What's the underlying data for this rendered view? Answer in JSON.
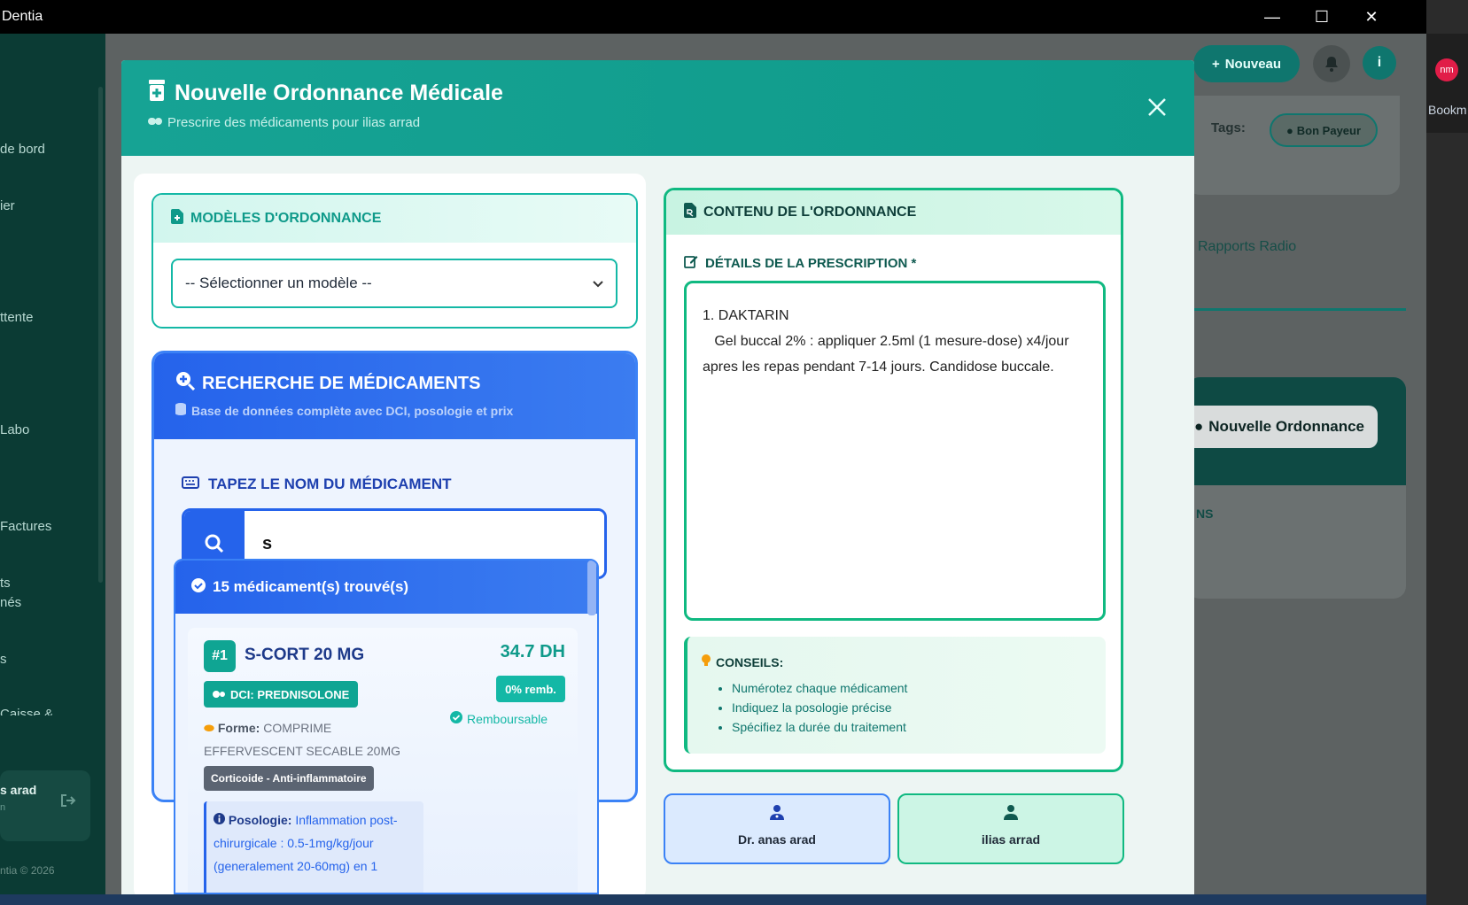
{
  "window": {
    "title": "Dentia",
    "minimize": "—",
    "maximize": "☐",
    "close": "✕"
  },
  "browser": {
    "profile_initials": "nm",
    "bookmarks_label": "Bookm"
  },
  "sidebar": {
    "items": [
      {
        "label": "de bord"
      },
      {
        "label": "ier"
      },
      {
        "label": "ttente"
      },
      {
        "label": "Labo"
      },
      {
        "label": "Factures"
      },
      {
        "label": "ts"
      },
      {
        "label": "nés"
      },
      {
        "label": "s"
      },
      {
        "label": "Caisse &"
      }
    ],
    "user_name": "s arad",
    "user_sub": "n",
    "footer": "ntia © 2026"
  },
  "topbar": {
    "nouveau_label": "Nouveau",
    "avatar_initial": "i"
  },
  "background": {
    "tags_label": "Tags:",
    "tag_bon_payeur": "Bon Payeur",
    "rapports_radio": "Rapports Radio",
    "nouvelle_ordonnance_btn": "Nouvelle Ordonnance",
    "section_ns": "NS"
  },
  "modal": {
    "title": "Nouvelle Ordonnance Médicale",
    "subtitle": "Prescrire des médicaments pour ilias arrad",
    "close": "✕",
    "models": {
      "heading": "MODÈLES D'ORDONNANCE",
      "select_value": "-- Sélectionner un modèle --"
    },
    "search": {
      "heading": "RECHERCHE DE MÉDICAMENTS",
      "subheading": "Base de données complète avec DCI, posologie et prix",
      "input_label": "TAPEZ LE NOM DU MÉDICAMENT",
      "input_value": "s"
    },
    "results": {
      "count_label": "15 médicament(s) trouvé(s)",
      "items": [
        {
          "rank": "#1",
          "name": "S-CORT 20 MG",
          "price": "34.7 DH",
          "remb_rate": "0% remb.",
          "remb_status": "Remboursable",
          "dci": "DCI: PREDNISOLONE",
          "forme_label": "Forme:",
          "forme_value": "COMPRIME EFFERVESCENT SECABLE 20MG",
          "classe": "Corticoide - Anti-inflammatoire",
          "posologie_label": "Posologie:",
          "posologie_value": "Inflammation post-chirurgicale : 0.5-1mg/kg/jour (generalement 20-60mg) en 1"
        }
      ]
    },
    "content": {
      "heading": "CONTENU DE L'ORDONNANCE",
      "details_label": "DÉTAILS DE LA PRESCRIPTION *",
      "prescription_text": "1. DAKTARIN\n   Gel buccal 2% : appliquer 2.5ml (1 mesure-dose) x4/jour apres les repas pendant 7-14 jours. Candidose buccale."
    },
    "conseils": {
      "title": "CONSEILS:",
      "items": [
        "Numérotez chaque médicament",
        "Indiquez la posologie précise",
        "Spécifiez la durée du traitement"
      ]
    },
    "doctor_name": "Dr. anas arad",
    "patient_name": "ilias arrad"
  },
  "colors": {
    "teal_primary": "#0f9a8a",
    "blue_primary": "#2563eb",
    "green_accent": "#10b981"
  }
}
